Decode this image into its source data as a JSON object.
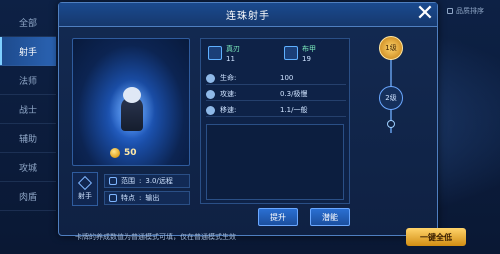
{
  "tabs": [
    {
      "label": "全部",
      "active": false
    },
    {
      "label": "射手",
      "active": true
    },
    {
      "label": "法师",
      "active": false
    },
    {
      "label": "战士",
      "active": false
    },
    {
      "label": "辅助",
      "active": false
    },
    {
      "label": "攻城",
      "active": false
    },
    {
      "label": "肉盾",
      "active": false
    }
  ],
  "sort_label": "品质排序",
  "dialog": {
    "title": "连珠射手",
    "cost": "50",
    "role_label": "射手",
    "attributes": [
      {
        "label": "范围",
        "value": "3.0/远程"
      },
      {
        "label": "特点",
        "value": "输出"
      }
    ],
    "equipment": [
      {
        "name": "真刃",
        "value": "11"
      },
      {
        "name": "布甲",
        "value": "19"
      }
    ],
    "stats": [
      {
        "label": "生命",
        "value": "100"
      },
      {
        "label": "攻速",
        "value": "0.3/极慢"
      },
      {
        "label": "移速",
        "value": "1.1/一般"
      }
    ],
    "buttons": {
      "upgrade": "提升",
      "skin": "潜能"
    },
    "levels": [
      {
        "label": "1级",
        "active": true
      },
      {
        "label": "2级",
        "active": false
      }
    ]
  },
  "note": "卡牌的养成数值为普通模式可填，仅在普通模式生效",
  "one_key": "一键全低"
}
